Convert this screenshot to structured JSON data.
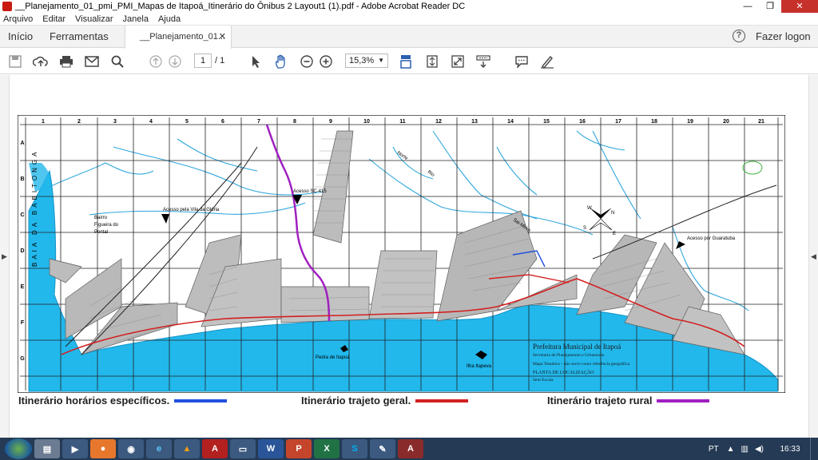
{
  "window": {
    "title": "__Planejamento_01_pmi_PMI_Mapas de Itapoá_Itinerário do Ônibus 2 Layout1 (1).pdf - Adobe Acrobat Reader DC",
    "minimize": "—",
    "maximize": "❐",
    "close": "✕"
  },
  "menu": [
    "Arquivo",
    "Editar",
    "Visualizar",
    "Janela",
    "Ajuda"
  ],
  "tabs": {
    "home": "Início",
    "tools": "Ferramentas",
    "doc": "__Planejamento_01...",
    "doc_close": "✕",
    "login": "Fazer logon",
    "help": "?"
  },
  "toolbar": {
    "page_current": "1",
    "page_total": "/ 1",
    "zoom": "15,3%",
    "icons": [
      "save-icon",
      "upload-icon",
      "print-icon",
      "mail-icon",
      "search-icon",
      "page-up-icon",
      "page-down-icon",
      "select-icon",
      "hand-icon",
      "zoom-out-icon",
      "zoom-in-icon",
      "scroll-mode-icon",
      "fit-page-icon",
      "fullscreen-icon",
      "read-mode-icon",
      "comment-icon",
      "sign-icon"
    ]
  },
  "map": {
    "col_labels": [
      "1",
      "2",
      "3",
      "4",
      "5",
      "6",
      "7",
      "8",
      "9",
      "10",
      "11",
      "12",
      "13",
      "14",
      "15",
      "16",
      "17",
      "18",
      "19",
      "20",
      "21"
    ],
    "row_labels": [
      "A",
      "B",
      "C",
      "D",
      "E",
      "F",
      "G"
    ],
    "bay_label": "BAIA DA BABITONGA",
    "place_labels": {
      "acesso_sc": "Acesso SC-415",
      "acesso_vila": "Acesso pela Vila da Glória",
      "acesso_guaratuba": "Acesso por Guaratuba",
      "bairro": "Bairro",
      "figueira": "Figueira do",
      "pontal": "Pontal",
      "pedra": "Pedra de Itapoá",
      "ilha": "Ilha Itapeva",
      "rio_saimirim": "Sai-Mirim",
      "norte": "Norte",
      "rio": "Rio"
    },
    "stamp": {
      "line1": "Prefeitura Municipal de Itapoá",
      "line2": "Secretaria de Planejamento e Urbanismo",
      "line3": "Mapa Temático - não serve como referência geográfica",
      "line4": "PLANTA DE LOCALIZAÇÃO",
      "line5": "Sem Escala"
    },
    "compass": {
      "n": "N",
      "s": "S",
      "w": "W",
      "e": "E"
    },
    "colors": {
      "sea": "#22b8ec",
      "river": "#2fa6dc",
      "street": "#888888",
      "grid": "#222222",
      "route_general": "#d22020",
      "route_rural": "#a020c0",
      "route_specific": "#2050e0"
    }
  },
  "legend": {
    "specific": "Itinerário horários específicos.",
    "general": "Itinerário trajeto geral.",
    "rural": "Itinerário trajeto rural"
  },
  "taskbar": {
    "apps": [
      "explorer",
      "media",
      "firefox",
      "chrome",
      "ie",
      "vlc",
      "acrobat",
      "notepad",
      "word",
      "powerpoint",
      "excel",
      "skype",
      "paint",
      "acrobat-reader"
    ],
    "lang": "PT",
    "time": "16:33"
  }
}
